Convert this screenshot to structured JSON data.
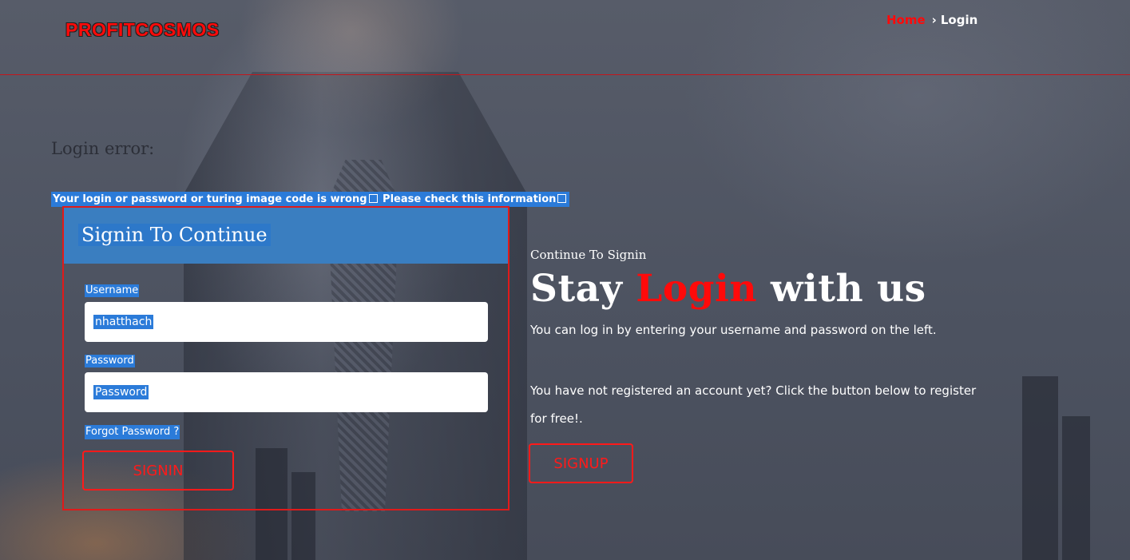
{
  "header": {
    "logo": "PROFITCOSMOS",
    "breadcrumb": {
      "home": "Home",
      "separator": "›",
      "current": "Login"
    }
  },
  "error": {
    "title": "Login error:",
    "message_part1": "Your login or password or turing image code is wrong",
    "message_part2": " Please check this information"
  },
  "login_form": {
    "title": "Signin To Continue",
    "username_label": "Username",
    "username_value": "nhatthach",
    "password_label": "Password",
    "password_value": "Password",
    "forgot_link": "Forgot Password ?",
    "signin_button": "SIGNIN"
  },
  "info": {
    "subtitle": "Continue To Signin",
    "heading_pre": "Stay ",
    "heading_highlight": "Login",
    "heading_post": " with us",
    "text1": "You can log in by entering your username and password on the left.",
    "text2": "You have not registered an account yet? Click the button below to register for free!.",
    "signup_button": "SIGNUP"
  },
  "colors": {
    "accent": "#ff0a0a",
    "panel_header": "#3a7ec0",
    "selection": "#2b7bd9"
  }
}
